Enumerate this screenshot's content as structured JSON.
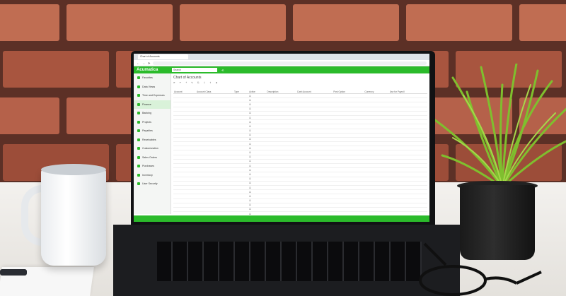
{
  "browser": {
    "tab_title": "Chart of Accounts"
  },
  "app": {
    "logo": "Acumatica",
    "search_placeholder": "Search",
    "page_title": "Chart of Accounts",
    "toolbar": [
      "⟳",
      "↶",
      "+",
      "✎",
      "⎘",
      "⇩",
      "⇧",
      "⊞"
    ],
    "status_message": "",
    "accent": "#2bbb2b"
  },
  "sidebar": {
    "items": [
      {
        "label": "Favorites",
        "icon": "star-icon"
      },
      {
        "label": "Data Views",
        "icon": "grid-icon"
      },
      {
        "label": "Time and Expenses",
        "icon": "clock-icon"
      },
      {
        "label": "Finance",
        "icon": "coin-icon"
      },
      {
        "label": "Banking",
        "icon": "bank-icon"
      },
      {
        "label": "Projects",
        "icon": "folder-icon"
      },
      {
        "label": "Payables",
        "icon": "wallet-icon"
      },
      {
        "label": "Receivables",
        "icon": "receipt-icon"
      },
      {
        "label": "Customization",
        "icon": "wrench-icon"
      },
      {
        "label": "Sales Orders",
        "icon": "cart-icon"
      },
      {
        "label": "Purchases",
        "icon": "bag-icon"
      },
      {
        "label": "Inventory",
        "icon": "box-icon"
      },
      {
        "label": "User Security",
        "icon": "lock-icon"
      }
    ],
    "active_index": 3
  },
  "table": {
    "columns": [
      "Account",
      "Account Class",
      "Type",
      "Active",
      "Description",
      "Cash Account",
      "Post Option",
      "Currency",
      "Use for Payroll"
    ],
    "rows": [
      [
        "",
        "",
        "",
        "☑",
        "",
        "",
        "",
        "",
        ""
      ],
      [
        "",
        "",
        "",
        "☑",
        "",
        "",
        "",
        "",
        ""
      ],
      [
        "",
        "",
        "",
        "☑",
        "",
        "",
        "",
        "",
        ""
      ],
      [
        "",
        "",
        "",
        "☑",
        "",
        "",
        "",
        "",
        ""
      ],
      [
        "",
        "",
        "",
        "☑",
        "",
        "",
        "",
        "",
        ""
      ],
      [
        "",
        "",
        "",
        "☑",
        "",
        "",
        "",
        "",
        ""
      ],
      [
        "",
        "",
        "",
        "☑",
        "",
        "",
        "",
        "",
        ""
      ],
      [
        "",
        "",
        "",
        "☑",
        "",
        "",
        "",
        "",
        ""
      ],
      [
        "",
        "",
        "",
        "☑",
        "",
        "",
        "",
        "",
        ""
      ],
      [
        "",
        "",
        "",
        "☑",
        "",
        "",
        "",
        "",
        ""
      ],
      [
        "",
        "",
        "",
        "☑",
        "",
        "",
        "",
        "",
        ""
      ],
      [
        "",
        "",
        "",
        "☑",
        "",
        "",
        "",
        "",
        ""
      ],
      [
        "",
        "",
        "",
        "☑",
        "",
        "",
        "",
        "",
        ""
      ],
      [
        "",
        "",
        "",
        "☑",
        "",
        "",
        "",
        "",
        ""
      ],
      [
        "",
        "",
        "",
        "☑",
        "",
        "",
        "",
        "",
        ""
      ],
      [
        "",
        "",
        "",
        "☑",
        "",
        "",
        "",
        "",
        ""
      ],
      [
        "",
        "",
        "",
        "☑",
        "",
        "",
        "",
        "",
        ""
      ],
      [
        "",
        "",
        "",
        "☑",
        "",
        "",
        "",
        "",
        ""
      ],
      [
        "",
        "",
        "",
        "☑",
        "",
        "",
        "",
        "",
        ""
      ],
      [
        "",
        "",
        "",
        "☑",
        "",
        "",
        "",
        "",
        ""
      ],
      [
        "",
        "",
        "",
        "☑",
        "",
        "",
        "",
        "",
        ""
      ],
      [
        "",
        "",
        "",
        "☑",
        "",
        "",
        "",
        "",
        ""
      ],
      [
        "",
        "",
        "",
        "☑",
        "",
        "",
        "",
        "",
        ""
      ],
      [
        "",
        "",
        "",
        "☑",
        "",
        "",
        "",
        "",
        ""
      ],
      [
        "",
        "",
        "",
        "☑",
        "",
        "",
        "",
        "",
        ""
      ],
      [
        "",
        "",
        "",
        "☑",
        "",
        "",
        "",
        "",
        ""
      ],
      [
        "",
        "",
        "",
        "☑",
        "",
        "",
        "",
        "",
        ""
      ],
      [
        "",
        "",
        "",
        "☑",
        "",
        "",
        "",
        "",
        ""
      ]
    ]
  }
}
